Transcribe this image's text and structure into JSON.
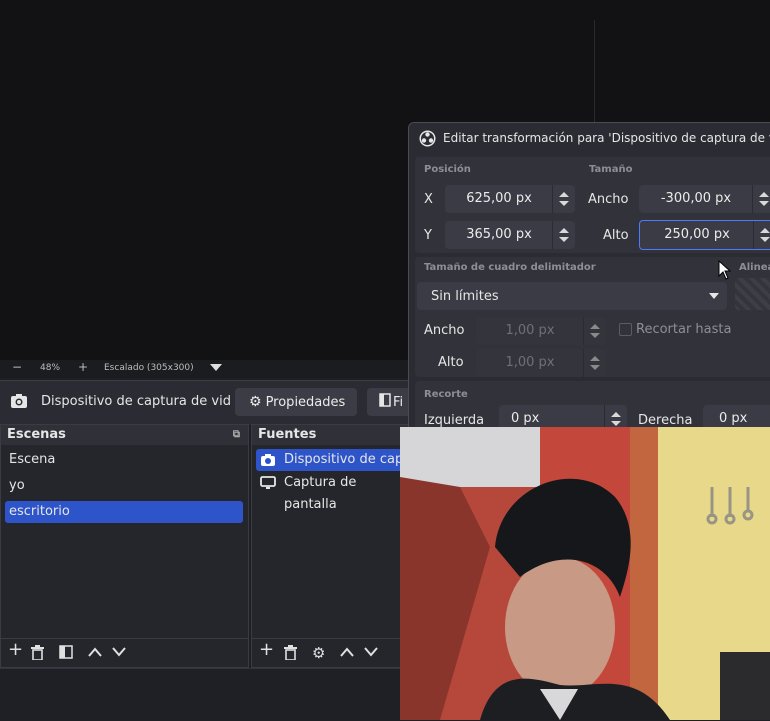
{
  "preview": {
    "zoom": "48%",
    "scaling": "Escalado (305x300)",
    "minus": "−",
    "plus": "+"
  },
  "source_toolbar": {
    "source_name": "Dispositivo de captura de vid",
    "properties_label": "Propiedades",
    "filters_label": "Fi"
  },
  "scenes": {
    "title": "Escenas",
    "items": [
      "Escena",
      "yo",
      "escritorio"
    ],
    "selected": "escritorio"
  },
  "sources": {
    "title": "Fuentes",
    "items": [
      "Dispositivo de capt",
      "Captura de pantalla"
    ],
    "selected": "Dispositivo de capt"
  },
  "transform": {
    "title": "Editar transformación para 'Dispositivo de captura de vid",
    "position_label": "Posición",
    "size_label": "Tamaño",
    "x_label": "X",
    "x_value": "625,00 px",
    "y_label": "Y",
    "y_value": "365,00 px",
    "width_label": "Ancho",
    "width_value": "-300,00 px",
    "height_label": "Alto",
    "height_value": "250,00 px",
    "bbox_label": "Tamaño de cuadro delimitador",
    "align_label": "Alinea",
    "bbox_type": "Sin límites",
    "bbox_width_label": "Ancho",
    "bbox_width_value": "1,00 px",
    "bbox_height_label": "Alto",
    "bbox_height_value": "1,00 px",
    "crop_to_bounds_label": "Recortar hasta",
    "crop_label": "Recorte",
    "crop_left_label": "Izquierda",
    "crop_left_value": "0 px",
    "crop_right_label": "Derecha",
    "crop_right_value": "0 px"
  },
  "colors": {
    "accent": "#2d55c9",
    "dock_bg": "#25262c",
    "panel_bg": "#2b2c33"
  },
  "icons": [
    "camera-icon",
    "gear-icon",
    "filter-icon",
    "monitor-icon",
    "add-icon",
    "trash-icon",
    "up-icon",
    "down-icon",
    "obs-logo-icon",
    "cursor-icon"
  ]
}
